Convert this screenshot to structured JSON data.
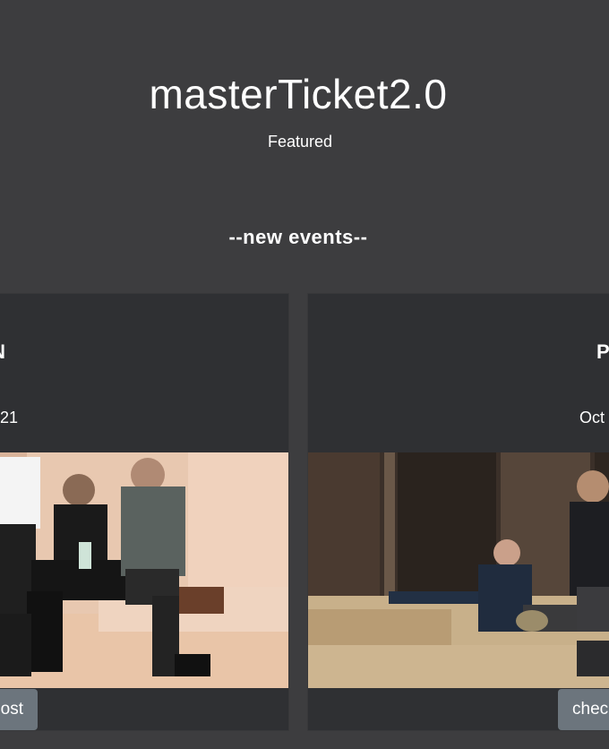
{
  "header": {
    "title": "masterTicket2.0",
    "subtitle": "Featured"
  },
  "section": {
    "title": "--new events--"
  },
  "events": [
    {
      "name": "N",
      "date": "21",
      "button_label": "ost",
      "image": "band-photo-seated-on-bench"
    },
    {
      "name": "P",
      "date": "Oct",
      "button_label": "chec",
      "image": "band-photo-on-couch"
    }
  ],
  "colors": {
    "background": "#3d3d3f",
    "card": "#2f3033",
    "button": "#6c757d",
    "text": "#ffffff"
  }
}
